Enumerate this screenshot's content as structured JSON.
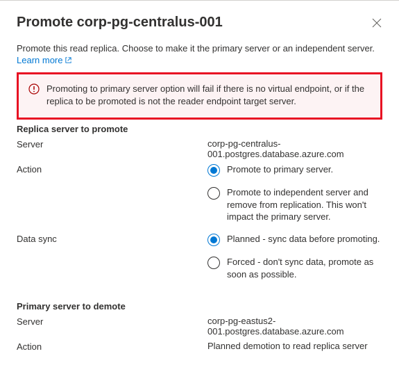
{
  "header": {
    "title": "Promote corp-pg-centralus-001"
  },
  "intro": {
    "text": "Promote this read replica. Choose to make it the primary server or an independent server.",
    "learn_more": "Learn more"
  },
  "alert": {
    "text": "Promoting to primary server option will fail if there is no virtual endpoint, or if the replica to be promoted is not the reader endpoint target server."
  },
  "replica": {
    "section_title": "Replica server to promote",
    "server_label": "Server",
    "server_value": "corp-pg-centralus-001.postgres.database.azure.com",
    "action_label": "Action",
    "action_options": [
      {
        "label": "Promote to primary server.",
        "selected": true
      },
      {
        "label": "Promote to independent server and remove from replication. This won't impact the primary server.",
        "selected": false
      }
    ],
    "datasync_label": "Data sync",
    "datasync_options": [
      {
        "label": "Planned - sync data before promoting.",
        "selected": true
      },
      {
        "label": "Forced - don't sync data, promote as soon as possible.",
        "selected": false
      }
    ]
  },
  "primary": {
    "section_title": "Primary server to demote",
    "server_label": "Server",
    "server_value": "corp-pg-eastus2-001.postgres.database.azure.com",
    "action_label": "Action",
    "action_value": "Planned demotion to read replica server"
  }
}
